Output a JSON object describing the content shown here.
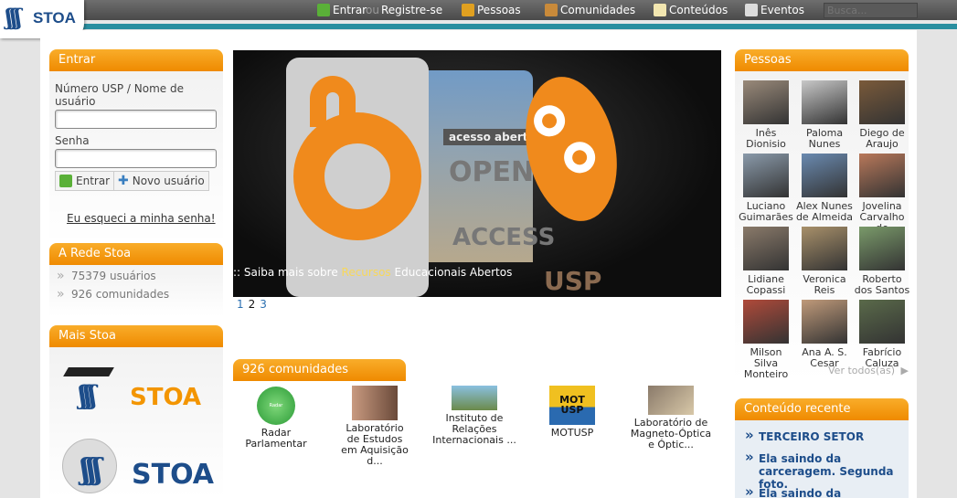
{
  "header": {
    "logo_text": "STOA",
    "nav": [
      {
        "label": "Entrar",
        "icon": "login-icon"
      },
      {
        "label": "ou"
      },
      {
        "label": "Registre-se"
      },
      {
        "label": "Pessoas",
        "icon": "people-icon"
      },
      {
        "label": "Comunidades",
        "icon": "communities-icon"
      },
      {
        "label": "Conteúdos",
        "icon": "contents-icon"
      },
      {
        "label": "Eventos",
        "icon": "calendar-icon"
      }
    ],
    "search_placeholder": "Busca..."
  },
  "login": {
    "title": "Entrar",
    "username_label": "Número USP / Nome de usuário",
    "password_label": "Senha",
    "login_button": "Entrar",
    "new_user_button": "Novo usuário",
    "forgot_link": "Eu esqueci a minha senha!"
  },
  "rede": {
    "title": "A Rede Stoa",
    "users": "75379 usuários",
    "communities": "926 comunidades"
  },
  "mais": {
    "title": "Mais Stoa",
    "logo_text": "STOA"
  },
  "slideshow": {
    "caption_prefix": ":: Saiba mais sobre ",
    "caption_highlight": "Recursos",
    "caption_suffix": " Educacionais Abertos",
    "image_text": {
      "sign": "acesso aberto",
      "open": "OPEN",
      "access": "ACCESS",
      "usp": "USP"
    },
    "pages": [
      "1",
      "2",
      "3"
    ]
  },
  "communities": {
    "title": "926 comunidades",
    "items": [
      {
        "name": "Radar Parlamentar",
        "thumb_text": "Radar Parlamentar"
      },
      {
        "name": "Laboratório de Estudos em Aquisição d..."
      },
      {
        "name": "Instituto de Relações Internacionais ..."
      },
      {
        "name": "MOTUSP",
        "thumb_text": "MOT USP"
      },
      {
        "name": "Laboratório de Magneto-Óptica e Óptic..."
      }
    ]
  },
  "people": {
    "title": "Pessoas",
    "items": [
      {
        "name": "Inês Dionisio"
      },
      {
        "name": "Paloma Nunes"
      },
      {
        "name": "Diego de Araujo"
      },
      {
        "name": "Luciano Guimarães"
      },
      {
        "name": "Alex Nunes de Almeida"
      },
      {
        "name": "Jovelina Carvalho de"
      },
      {
        "name": "Lidiane Copassi"
      },
      {
        "name": "Veronica Reis"
      },
      {
        "name": "Roberto dos Santos"
      },
      {
        "name": "Milson Silva Monteiro"
      },
      {
        "name": "Ana A. S. Cesar"
      },
      {
        "name": "Fabrício Caluza"
      }
    ],
    "see_all": "Ver todos(as)"
  },
  "recent": {
    "title": "Conteúdo recente",
    "items": [
      "TERCEIRO SETOR",
      "Ela saindo da carceragem. Segunda foto.",
      "Ela saindo da carceragem."
    ]
  },
  "colors": {
    "accent": "#f39500",
    "topbar": "#555555",
    "stripe": "#2a8fa0",
    "link": "#1d4d8a"
  }
}
